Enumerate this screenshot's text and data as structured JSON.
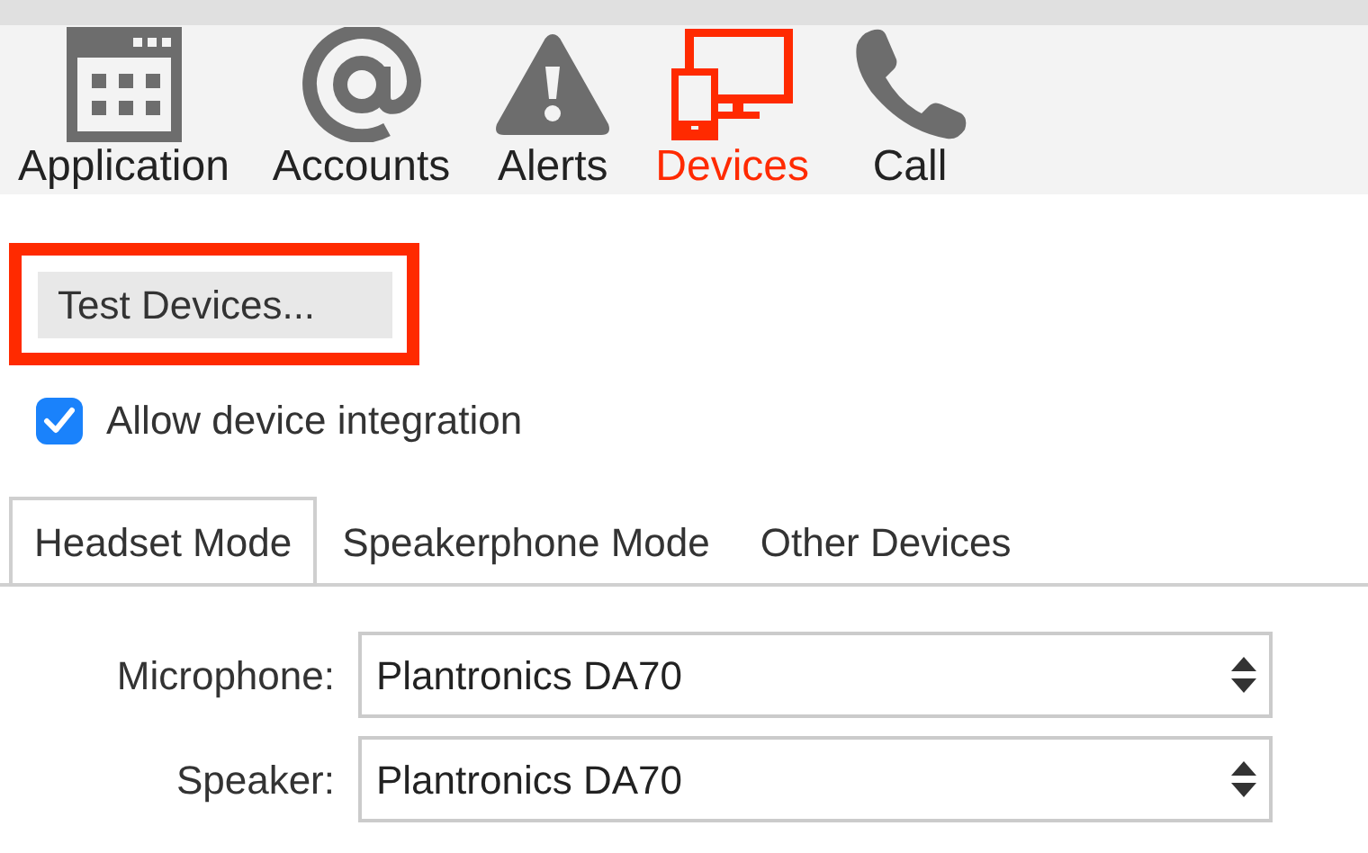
{
  "toolbar": [
    {
      "label": "Application",
      "kind": "calendar",
      "selected": false
    },
    {
      "label": "Accounts",
      "kind": "at",
      "selected": false
    },
    {
      "label": "Alerts",
      "kind": "warning",
      "selected": false
    },
    {
      "label": "Devices",
      "kind": "devices",
      "selected": true
    },
    {
      "label": "Call",
      "kind": "phone",
      "selected": false
    }
  ],
  "test_button": {
    "label": "Test Devices...",
    "highlighted": true
  },
  "integration": {
    "label": "Allow device integration",
    "checked": true
  },
  "tabs": [
    {
      "label": "Headset Mode",
      "selected": true
    },
    {
      "label": "Speakerphone Mode",
      "selected": false
    },
    {
      "label": "Other Devices",
      "selected": false
    }
  ],
  "fields": [
    {
      "label": "Microphone:",
      "value": "Plantronics DA70"
    },
    {
      "label": "Speaker:",
      "value": "Plantronics DA70"
    }
  ]
}
